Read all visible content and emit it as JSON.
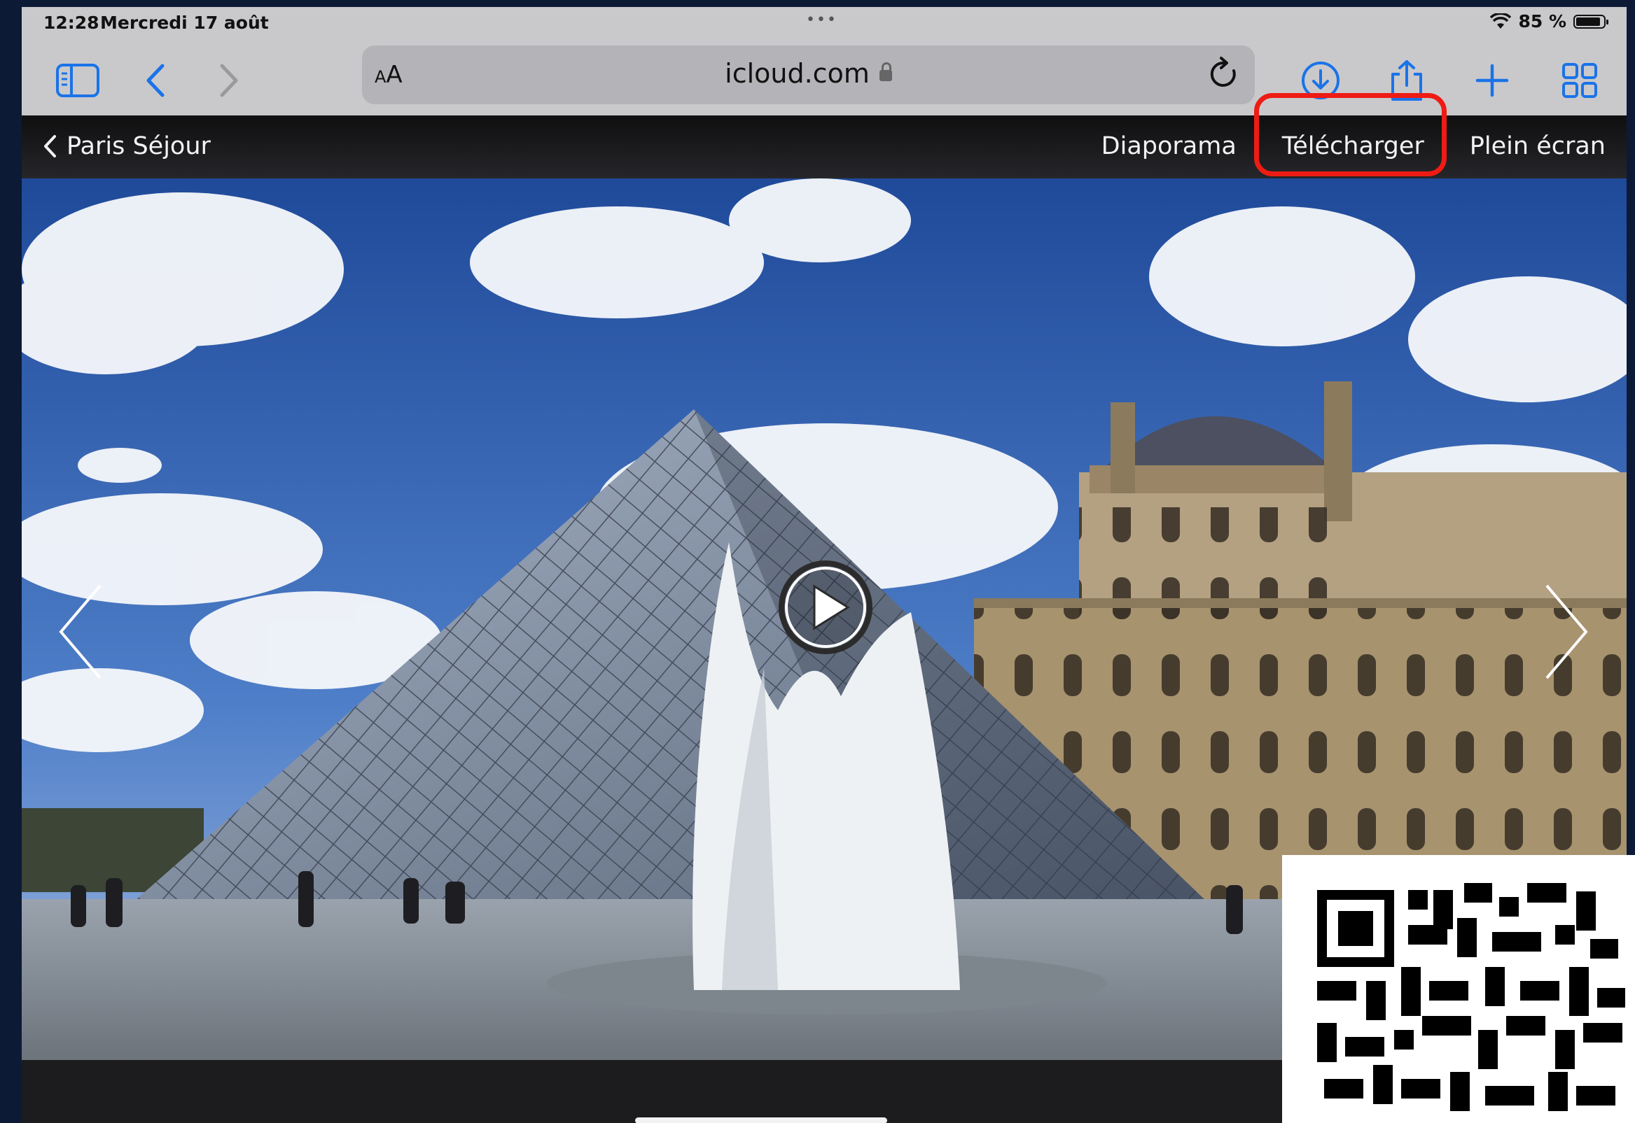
{
  "status_bar": {
    "time": "12:28",
    "date": "Mercredi 17 août",
    "battery": "85 %"
  },
  "safari": {
    "url": "icloud.com",
    "text_size_button": "AA",
    "icons": [
      "sidebar-icon",
      "back-icon",
      "forward-icon",
      "reload-icon",
      "download-icon",
      "share-icon",
      "new-tab-icon",
      "tabs-overview-icon"
    ]
  },
  "viewer": {
    "back_label": "Paris Séjour",
    "actions": {
      "slideshow": "Diaporama",
      "download": "Télécharger",
      "fullscreen": "Plein écran"
    }
  },
  "colors": {
    "accent": "#1a73e8",
    "highlight": "#ee1c14"
  }
}
